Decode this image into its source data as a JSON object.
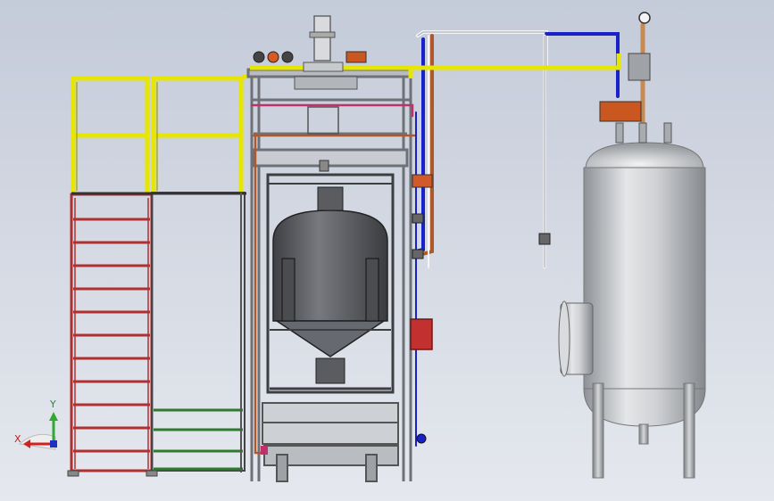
{
  "triad": {
    "y_label": "Y",
    "x_label": "X"
  },
  "colors": {
    "rail_yellow": "#e6e600",
    "ladder_red": "#b03030",
    "ladder_green": "#2f7a2f",
    "pipe_blue": "#1822c8",
    "pipe_copper": "#b0582a",
    "pipe_magenta": "#c0306a",
    "frame_grey": "#8a8f96",
    "vessel_dark": "#5c5f64",
    "tank_silver": "#c9cbce"
  }
}
